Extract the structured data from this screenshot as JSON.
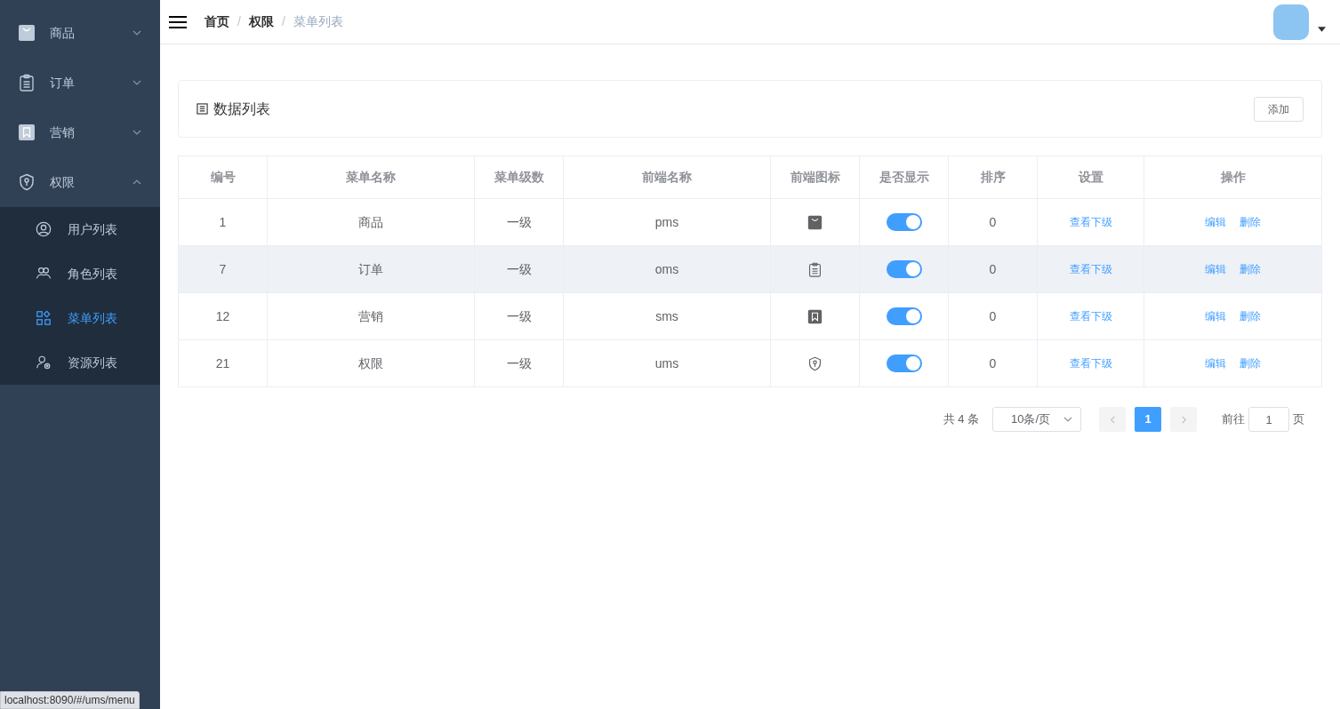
{
  "sidebar": {
    "items": [
      {
        "label": "商品",
        "expanded": false
      },
      {
        "label": "订单",
        "expanded": false
      },
      {
        "label": "营销",
        "expanded": false
      },
      {
        "label": "权限",
        "expanded": true,
        "children": [
          {
            "label": "用户列表",
            "selected": false
          },
          {
            "label": "角色列表",
            "selected": false
          },
          {
            "label": "菜单列表",
            "selected": true
          },
          {
            "label": "资源列表",
            "selected": false
          }
        ]
      }
    ]
  },
  "breadcrumb_separator": "/",
  "breadcrumb": [
    {
      "label": "首页",
      "current": false
    },
    {
      "label": "权限",
      "current": false
    },
    {
      "label": "菜单列表",
      "current": true
    }
  ],
  "panel": {
    "title": "数据列表",
    "add_button": "添加"
  },
  "table": {
    "columns": [
      "编号",
      "菜单名称",
      "菜单级数",
      "前端名称",
      "前端图标",
      "是否显示",
      "排序",
      "设置",
      "操作"
    ],
    "rows": [
      {
        "id": "1",
        "name": "商品",
        "level_text": "一级",
        "frontend": "pms",
        "hovered": false,
        "on": true,
        "sort": "0",
        "settings": "查看下级",
        "edit": "编辑",
        "delete": "删除"
      },
      {
        "id": "7",
        "name": "订单",
        "level_text": "一级",
        "frontend": "oms",
        "hovered": true,
        "on": true,
        "sort": "0",
        "settings": "查看下级",
        "edit": "编辑",
        "delete": "删除"
      },
      {
        "id": "12",
        "name": "营销",
        "level_text": "一级",
        "frontend": "sms",
        "hovered": false,
        "on": true,
        "sort": "0",
        "settings": "查看下级",
        "edit": "编辑",
        "delete": "删除"
      },
      {
        "id": "21",
        "name": "权限",
        "level_text": "一级",
        "frontend": "ums",
        "hovered": false,
        "on": true,
        "sort": "0",
        "settings": "查看下级",
        "edit": "编辑",
        "delete": "删除"
      }
    ]
  },
  "pagination": {
    "total": "共 4 条",
    "page_size": "10条/页",
    "pages": [
      {
        "label": "1",
        "selected": true
      }
    ],
    "goto_label": "前往",
    "goto_value": "1",
    "goto_suffix": "页"
  },
  "status_bar": "localhost:8090/#/ums/menu"
}
